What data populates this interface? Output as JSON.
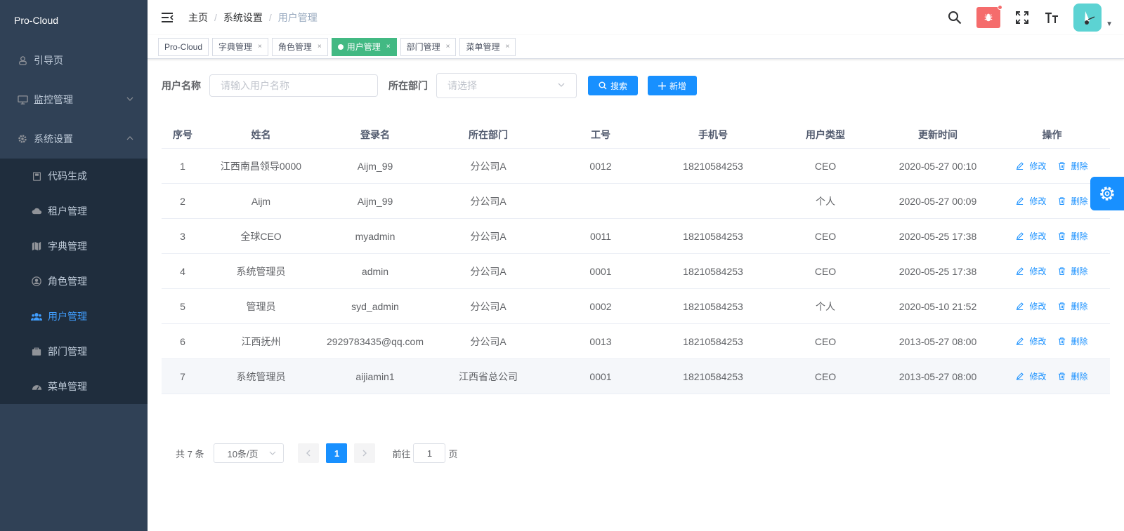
{
  "app": {
    "title": "Pro-Cloud"
  },
  "sidebar": {
    "items": [
      {
        "label": "引导页",
        "icon": "guide-icon"
      },
      {
        "label": "监控管理",
        "icon": "monitor-icon"
      },
      {
        "label": "系统设置",
        "icon": "gear-icon"
      }
    ],
    "sub_items": [
      {
        "label": "代码生成",
        "icon": "code-icon"
      },
      {
        "label": "租户管理",
        "icon": "cloud-icon"
      },
      {
        "label": "字典管理",
        "icon": "map-icon"
      },
      {
        "label": "角色管理",
        "icon": "role-icon"
      },
      {
        "label": "用户管理",
        "icon": "users-icon"
      },
      {
        "label": "部门管理",
        "icon": "briefcase-icon"
      },
      {
        "label": "菜单管理",
        "icon": "dashboard-icon"
      }
    ]
  },
  "breadcrumb": [
    "主页",
    "系统设置",
    "用户管理"
  ],
  "tags": [
    {
      "label": "Pro-Cloud"
    },
    {
      "label": "字典管理"
    },
    {
      "label": "角色管理"
    },
    {
      "label": "用户管理"
    },
    {
      "label": "部门管理"
    },
    {
      "label": "菜单管理"
    }
  ],
  "filters": {
    "username_label": "用户名称",
    "username_placeholder": "请输入用户名称",
    "dept_label": "所在部门",
    "dept_placeholder": "请选择",
    "search_label": "搜索",
    "add_label": "新增"
  },
  "table": {
    "headers": [
      "序号",
      "姓名",
      "登录名",
      "所在部门",
      "工号",
      "手机号",
      "用户类型",
      "更新时间",
      "操作"
    ],
    "edit_label": "修改",
    "delete_label": "删除",
    "rows": [
      [
        "1",
        "江西南昌领导0000",
        "Aijm_99",
        "分公司A",
        "0012",
        "18210584253",
        "CEO",
        "2020-05-27 00:10"
      ],
      [
        "2",
        "Aijm",
        "Aijm_99",
        "分公司A",
        "",
        "",
        "个人",
        "2020-05-27 00:09"
      ],
      [
        "3",
        "全球CEO",
        "myadmin",
        "分公司A",
        "0011",
        "18210584253",
        "CEO",
        "2020-05-25 17:38"
      ],
      [
        "4",
        "系统管理员",
        "admin",
        "分公司A",
        "0001",
        "18210584253",
        "CEO",
        "2020-05-25 17:38"
      ],
      [
        "5",
        "管理员",
        "syd_admin",
        "分公司A",
        "0002",
        "18210584253",
        "个人",
        "2020-05-10 21:52"
      ],
      [
        "6",
        "江西抚州",
        "2929783435@qq.com",
        "分公司A",
        "0013",
        "18210584253",
        "CEO",
        "2013-05-27 08:00"
      ],
      [
        "7",
        "系统管理员",
        "aijiamin1",
        "江西省总公司",
        "0001",
        "18210584253",
        "CEO",
        "2013-05-27 08:00"
      ]
    ]
  },
  "pagination": {
    "total": "共 7 条",
    "page_size": "10条/页",
    "current_page": "1",
    "jump_prefix": "前往",
    "jump_value": "1",
    "jump_suffix": "页"
  },
  "colors": {
    "sidebar_bg": "#304156",
    "primary": "#1890ff",
    "active_tag": "#42b983",
    "bug_red": "#f56c6c"
  }
}
